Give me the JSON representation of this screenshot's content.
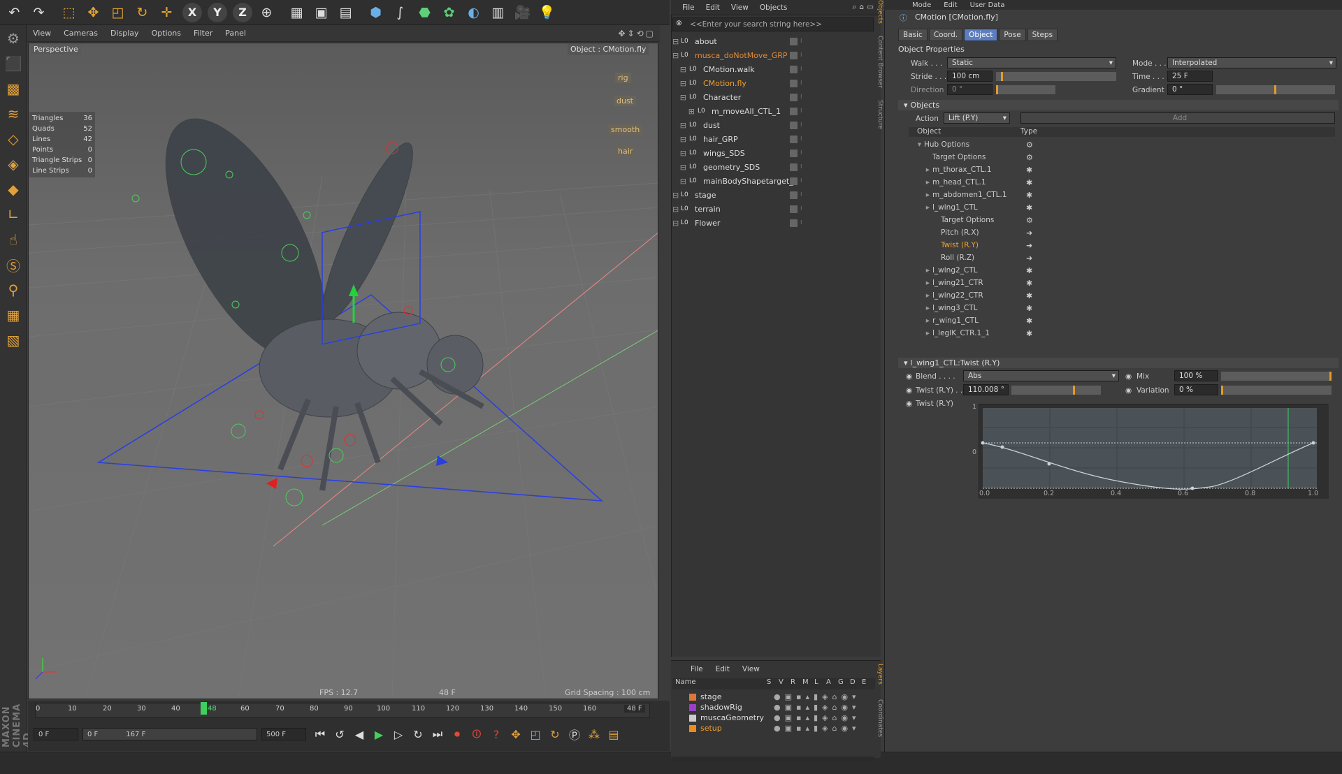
{
  "toolbar": {
    "icons": [
      "undo-icon",
      "redo-icon",
      "select-icon",
      "move-icon",
      "scale-icon",
      "rotate-icon",
      "world-move-icon",
      "x-axis-icon",
      "y-axis-icon",
      "z-axis-icon",
      "coord-system-icon",
      "render-view-icon",
      "render-picture-viewer-icon",
      "render-settings-icon",
      "cube-icon",
      "spline-icon",
      "nurbs-icon",
      "array-icon",
      "deformer-icon",
      "floor-icon",
      "camera-icon",
      "light-icon"
    ],
    "xyz": [
      "X",
      "Y",
      "Z"
    ]
  },
  "viewport": {
    "menu": [
      "View",
      "Cameras",
      "Display",
      "Options",
      "Filter",
      "Panel"
    ],
    "camera": "Perspective",
    "object_label": "Object : CMotion.fly",
    "stats": [
      {
        "label": "Triangles",
        "value": "36"
      },
      {
        "label": "Quads",
        "value": "52"
      },
      {
        "label": "Lines",
        "value": "42"
      },
      {
        "label": "Points",
        "value": "0"
      },
      {
        "label": "Triangle Strips",
        "value": "0"
      },
      {
        "label": "Line Strips",
        "value": "0"
      }
    ],
    "tags": [
      "rig",
      "dust",
      "smooth",
      "hair"
    ],
    "fps": "FPS : 12.7",
    "frame": "48 F",
    "grid": "Grid Spacing : 100 cm"
  },
  "timeline": {
    "ticks": [
      "0",
      "10",
      "20",
      "30",
      "40",
      "48",
      "60",
      "70",
      "80",
      "90",
      "100",
      "110",
      "120",
      "130",
      "140",
      "150",
      "160"
    ],
    "current": "48 F",
    "start": "0 F",
    "range_start": "0 F",
    "range_end": "167 F",
    "end": "500 F"
  },
  "brand": "MAXON CINEMA 4D",
  "objects": {
    "menu": [
      "File",
      "Edit",
      "View",
      "Objects"
    ],
    "search_placeholder": "<<Enter your search string here>>",
    "items": [
      {
        "name": "about",
        "indent": 0,
        "color": "#dddddd"
      },
      {
        "name": "musca_doNotMove_GRP",
        "indent": 0,
        "color": "#e08a3a"
      },
      {
        "name": "CMotion.walk",
        "indent": 1,
        "color": "#dddddd"
      },
      {
        "name": "CMotion.fly",
        "indent": 1,
        "color": "#f0a030"
      },
      {
        "name": "Character",
        "indent": 1,
        "color": "#dddddd"
      },
      {
        "name": "m_moveAll_CTL_1",
        "indent": 2,
        "color": "#dddddd"
      },
      {
        "name": "dust",
        "indent": 1,
        "color": "#dddddd"
      },
      {
        "name": "hair_GRP",
        "indent": 1,
        "color": "#dddddd"
      },
      {
        "name": "wings_SDS",
        "indent": 1,
        "color": "#dddddd"
      },
      {
        "name": "geometry_SDS",
        "indent": 1,
        "color": "#dddddd"
      },
      {
        "name": "mainBodyShapetarget_",
        "indent": 1,
        "color": "#dddddd"
      },
      {
        "name": "stage",
        "indent": 0,
        "color": "#dddddd"
      },
      {
        "name": "terrain",
        "indent": 0,
        "color": "#dddddd"
      },
      {
        "name": "Flower",
        "indent": 0,
        "color": "#dddddd"
      }
    ],
    "side_tabs": [
      "Objects",
      "Content Browser",
      "Structure"
    ]
  },
  "layers": {
    "menu": [
      "File",
      "Edit",
      "View"
    ],
    "columns": [
      "Name",
      "S",
      "V",
      "R",
      "M",
      "L",
      "A",
      "G",
      "D",
      "E"
    ],
    "items": [
      {
        "name": "stage",
        "color": "#d9783a"
      },
      {
        "name": "shadowRig",
        "color": "#9a3fc8"
      },
      {
        "name": "muscaGeometry",
        "color": "#cccccc"
      },
      {
        "name": "setup",
        "color": "#f08a1a",
        "text_color": "#f0a030"
      }
    ],
    "side_tabs": [
      "Layers",
      "Coordinates"
    ]
  },
  "attributes": {
    "menu": [
      "Mode",
      "Edit",
      "User Data"
    ],
    "title": "CMotion [CMotion.fly]",
    "tabs": [
      "Basic",
      "Coord.",
      "Object",
      "Pose",
      "Steps"
    ],
    "active_tab": "Object",
    "section1": "Object Properties",
    "walk_label": "Walk . . .",
    "walk_value": "Static",
    "mode_label": "Mode . . .",
    "mode_value": "Interpolated",
    "stride_label": "Stride . . .",
    "stride_value": "100 cm",
    "time_label": "Time . . .",
    "time_value": "25 F",
    "direction_label": "Direction",
    "direction_value": "0 °",
    "gradient_label": "Gradient",
    "gradient_value": "0 °",
    "section2": "Objects",
    "action_label": "Action",
    "action_value": "Lift (P.Y)",
    "add_label": "Add",
    "tree_cols": [
      "Object",
      "Type"
    ],
    "tree": [
      {
        "name": "Hub Options",
        "level": 0,
        "type": "gear"
      },
      {
        "name": "Target Options",
        "level": 1,
        "type": "gear"
      },
      {
        "name": "m_thorax_CTL.1",
        "level": 1,
        "type": "star"
      },
      {
        "name": "m_head_CTL.1",
        "level": 1,
        "type": "star"
      },
      {
        "name": "m_abdomen1_CTL.1",
        "level": 1,
        "type": "star"
      },
      {
        "name": "l_wing1_CTL",
        "level": 1,
        "type": "star"
      },
      {
        "name": "Target Options",
        "level": 2,
        "type": "gear"
      },
      {
        "name": "Pitch (R.X)",
        "level": 2,
        "type": "arrow"
      },
      {
        "name": "Twist (R.Y)",
        "level": 2,
        "type": "arrow",
        "highlight": true
      },
      {
        "name": "Roll (R.Z)",
        "level": 2,
        "type": "arrow"
      },
      {
        "name": "l_wing2_CTL",
        "level": 1,
        "type": "star"
      },
      {
        "name": "l_wing21_CTR",
        "level": 1,
        "type": "star"
      },
      {
        "name": "l_wing22_CTR",
        "level": 1,
        "type": "star"
      },
      {
        "name": "l_wing3_CTL",
        "level": 1,
        "type": "star"
      },
      {
        "name": "r_wing1_CTL",
        "level": 1,
        "type": "star"
      },
      {
        "name": "l_legIK_CTR.1_1",
        "level": 1,
        "type": "star"
      }
    ],
    "section3": "l_wing1_CTL:Twist (R.Y)",
    "blend_label": "Blend . . . .",
    "blend_value": "Abs",
    "mix_label": "Mix",
    "mix_value": "100 %",
    "twist_label": "Twist (R.Y) . .",
    "twist_value": "110.008 °",
    "variation_label": "Variation",
    "variation_value": "0 %",
    "twist_curve_label": "Twist (R.Y)",
    "graph_yticks": [
      "1",
      "0"
    ],
    "graph_xticks": [
      "0.0",
      "0.2",
      "0.4",
      "0.6",
      "0.8",
      "1.0"
    ],
    "slider_levels": {
      "stride": 0.05,
      "direction": 0.0,
      "gradient": 0.5,
      "mix": 1.0,
      "twist": 0.7,
      "variation": 0.0
    }
  }
}
